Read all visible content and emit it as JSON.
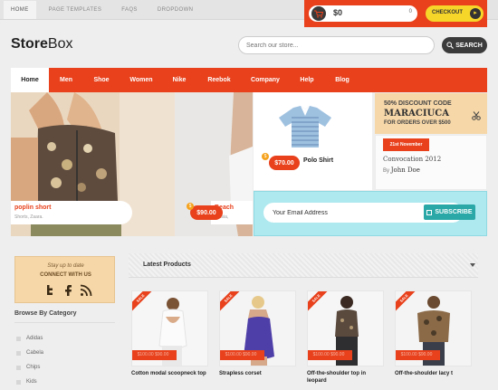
{
  "topbar": {
    "links": [
      "HOME",
      "PAGE TEMPLATES",
      "FAQS",
      "DROPDOWN"
    ],
    "cart_amount": "$0",
    "cart_count": "0",
    "checkout_label": "CHECKOUT"
  },
  "logo": {
    "bold": "Store",
    "light": "Box"
  },
  "search": {
    "placeholder": "Search our store...",
    "button_label": "SEARCH"
  },
  "nav": [
    "Home",
    "Men",
    "Shoe",
    "Women",
    "Nike",
    "Reebok",
    "Company",
    "Help",
    "Blog"
  ],
  "hero": {
    "left_product": "poplin short",
    "left_sub": "Shorts, Zaara.",
    "mid_product": "Beach",
    "mid_sub": "Cuisia,",
    "mid_price": "$90.00",
    "polo_price": "$70.00",
    "polo_name": "Polo Shirt"
  },
  "discount": {
    "line1": "50% DISCOUNT CODE",
    "code": "MARACIUCA",
    "line3": "FOR ORDERS OVER $500"
  },
  "blog": {
    "date": "21st November",
    "title": "Convocation 2012",
    "by_label": "By",
    "author": "John Doe"
  },
  "newsletter": {
    "value": "Your Email Address",
    "button_label": "SUBSCRIBE"
  },
  "stay": {
    "line1": "Stay up to date",
    "line2": "CONNECT WITH US"
  },
  "browse": {
    "title": "Browse By Category",
    "items": [
      "Adidas",
      "Cabela",
      "Chips",
      "Kids"
    ]
  },
  "latest": {
    "title": "Latest Products",
    "sale_label": "SALE",
    "products": [
      {
        "name": "Cotton modal scoopneck top",
        "price": "$100.00 $90.00"
      },
      {
        "name": "Strapless corset",
        "price": "$100.00 $90.00"
      },
      {
        "name": "Off-the-shoulder top in leopard",
        "price": "$100.00 $90.00"
      },
      {
        "name": "Off-the-shoulder lacy t",
        "price": "$100.00 $90.00"
      }
    ]
  },
  "colors": {
    "accent": "#e8411c",
    "checkout": "#f7d62a",
    "newsletter": "#aee9ef",
    "promo": "#f6d7a8"
  }
}
